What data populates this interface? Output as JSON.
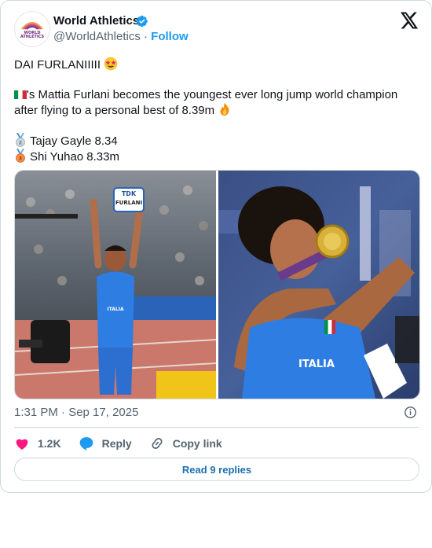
{
  "account": {
    "name": "World Athletics",
    "handle": "@WorldAthletics",
    "separator": "·",
    "follow_label": "Follow",
    "avatar_text_line1": "WORLD",
    "avatar_text_line2": "ATHLETICS"
  },
  "tweet": {
    "line1": "DAI FURLANIIIII",
    "line2": "'s Mattia Furlani becomes the youngest ever long jump world champion after flying to a personal best of 8.39m",
    "line3": "Tajay Gayle 8.34",
    "line4": "Shi Yuhao 8.33m",
    "emojis": [
      "star-struck-emoji",
      "italy-flag-emoji",
      "fire-emoji",
      "silver-medal-emoji",
      "bronze-medal-emoji"
    ]
  },
  "media": {
    "left_photo_sign_top": "TDK",
    "left_photo_sign_bottom": "FURLANI",
    "right_photo_jersey": "ITALIA"
  },
  "meta": {
    "timestamp": "1:31 PM · Sep 17, 2025"
  },
  "actions": {
    "likes": "1.2K",
    "reply_label": "Reply",
    "copy_label": "Copy link"
  },
  "replies_button": "Read 9 replies",
  "colors": {
    "accent": "#1d9bf0",
    "like_red": "#f91880",
    "text": "#0f1419",
    "muted": "#536471",
    "border": "#cfd9de"
  }
}
